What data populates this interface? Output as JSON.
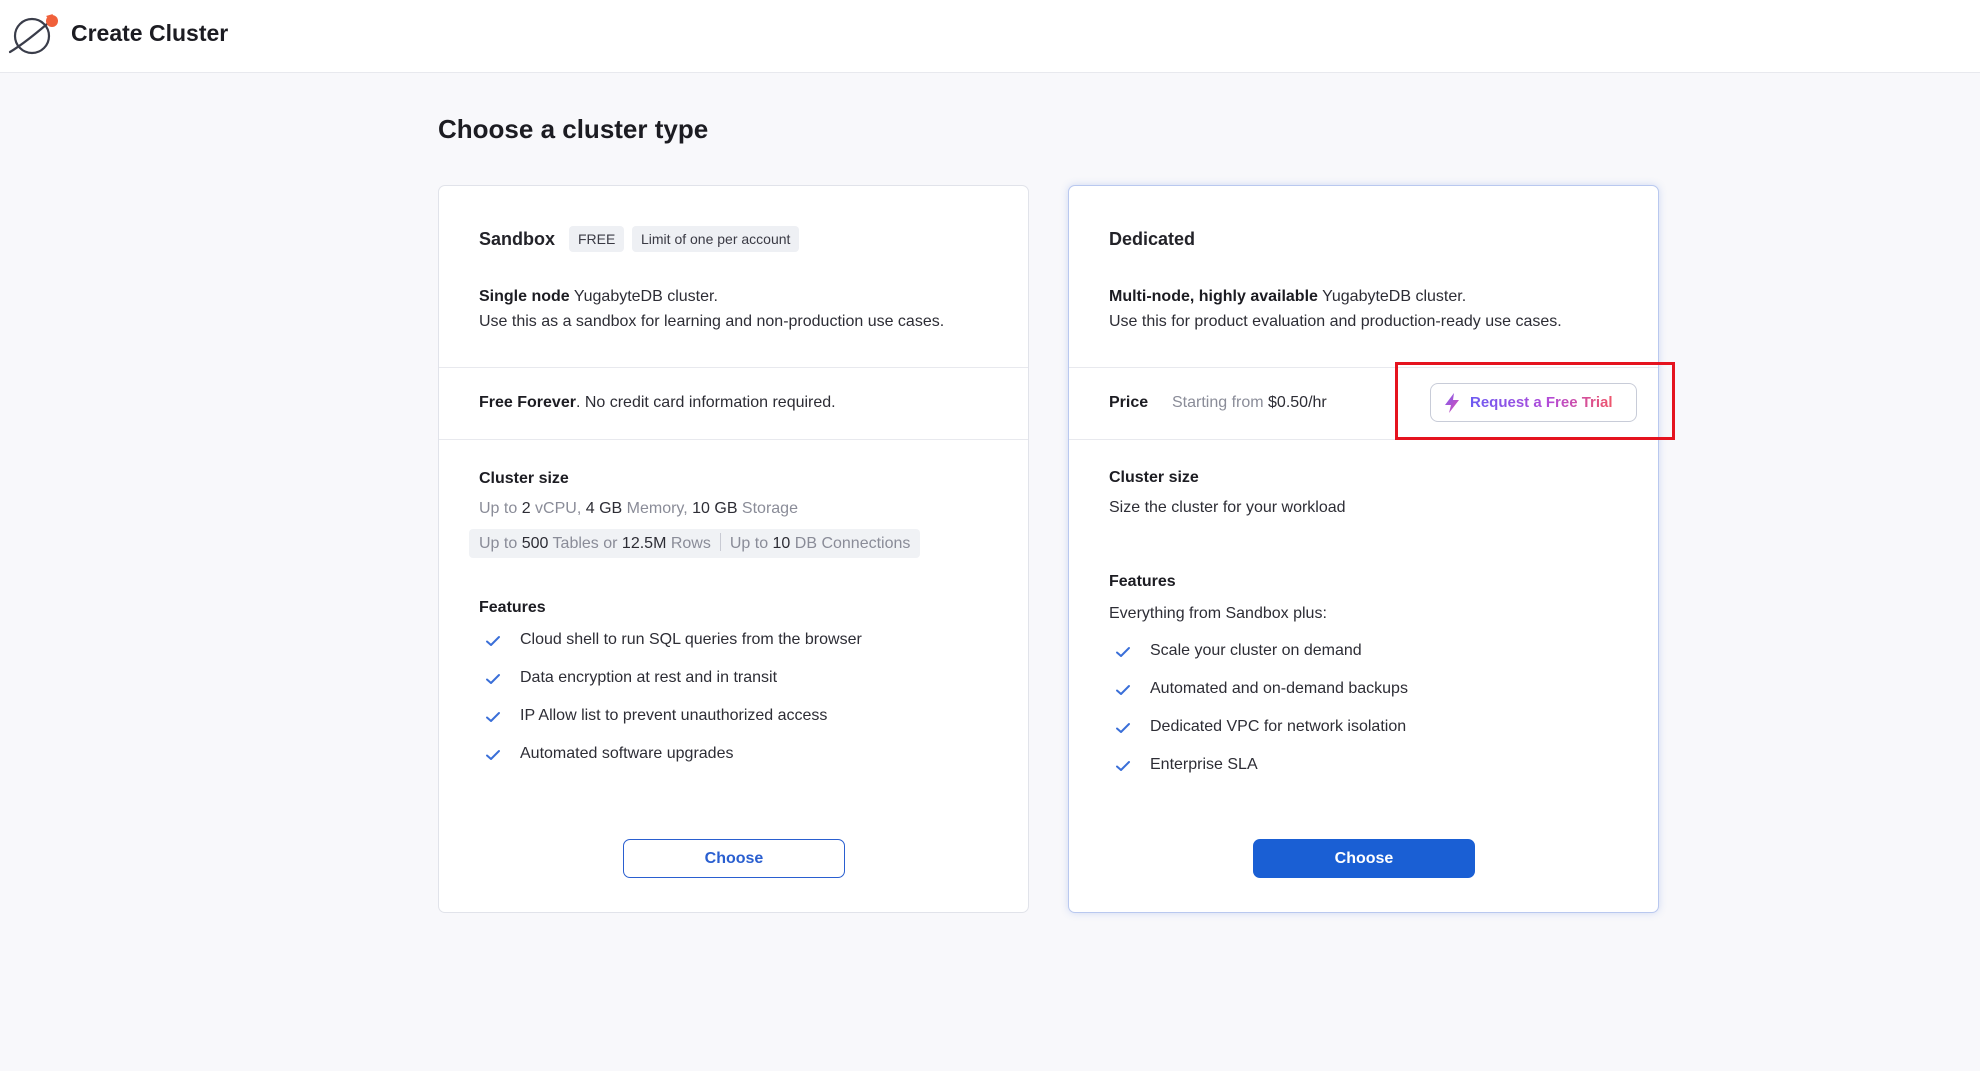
{
  "header": {
    "title": "Create Cluster",
    "logo": "yugabyte-planet-logo"
  },
  "page_title": "Choose a cluster type",
  "sandbox": {
    "title": "Sandbox",
    "badges": [
      "FREE",
      "Limit of one per account"
    ],
    "desc_bold": "Single node",
    "desc_rest": " YugabyteDB cluster.",
    "desc_line2": "Use this as a sandbox for learning and non-production use cases.",
    "price_bold": "Free Forever",
    "price_rest": ". No credit card information required.",
    "size_label": "Cluster size",
    "spec1": {
      "a": "Up to ",
      "b": "2",
      "c": " vCPU, ",
      "d": "4 GB",
      "e": " Memory, ",
      "f": "10 GB",
      "g": " Storage"
    },
    "spec2": {
      "a": "Up to ",
      "b": "500",
      "c": " Tables or ",
      "d": "12.5M",
      "e": " Rows",
      "h": "Up to ",
      "i": "10",
      "j": " DB Connections"
    },
    "features_label": "Features",
    "features": [
      "Cloud shell to run SQL queries from the browser",
      "Data encryption at rest and in transit",
      "IP Allow list to prevent unauthorized access",
      "Automated software upgrades"
    ],
    "choose_label": "Choose"
  },
  "dedicated": {
    "title": "Dedicated",
    "desc_bold": "Multi-node, highly available",
    "desc_rest": " YugabyteDB cluster.",
    "desc_line2": "Use this for product evaluation and production-ready use cases.",
    "price_label": "Price",
    "price_prefix": "Starting from ",
    "price_value": "$0.50/hr",
    "trial_label": "Request a Free Trial",
    "size_label": "Cluster size",
    "size_desc": "Size the cluster for your workload",
    "features_label": "Features",
    "features_intro": "Everything from Sandbox plus:",
    "features": [
      "Scale your cluster on demand",
      "Automated and on-demand backups",
      "Dedicated VPC for network isolation",
      "Enterprise SLA"
    ],
    "choose_label": "Choose"
  },
  "colors": {
    "primary": "#1a5fd4",
    "highlight": "#e5131f",
    "check": "#3a6fd8"
  }
}
